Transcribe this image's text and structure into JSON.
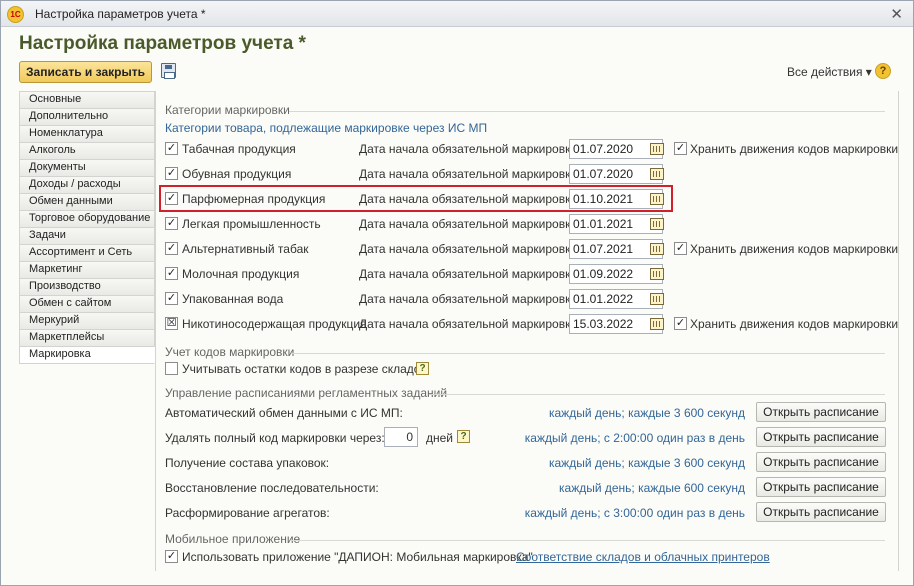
{
  "window": {
    "title": "Настройка параметров учета *",
    "logo": "1С"
  },
  "page": {
    "heading": "Настройка параметров учета *"
  },
  "toolbar": {
    "save_close": "Записать и закрыть",
    "all_actions": "Все действия ▾",
    "help": "?"
  },
  "nav": {
    "items": [
      "Основные",
      "Дополнительно",
      "Номенклатура",
      "Алкоголь",
      "Документы",
      "Доходы / расходы",
      "Обмен данными",
      "Торговое оборудование",
      "Задачи",
      "Ассортимент и Сеть",
      "Маркетинг",
      "Производство",
      "Обмен с сайтом",
      "Меркурий",
      "Маркетплейсы",
      "Маркировка"
    ],
    "active": "Маркировка"
  },
  "categories": {
    "title": "Категории маркировки",
    "subtitle": "Категории товара, подлежащие маркировке через ИС МП",
    "date_label": "Дата начала обязательной маркировки:",
    "store_label": "Хранить движения кодов маркировки",
    "rows": [
      {
        "name": "Табачная продукция",
        "date": "01.07.2020",
        "store": true,
        "state": "checked"
      },
      {
        "name": "Обувная продукция",
        "date": "01.07.2020",
        "store": false,
        "state": "checked"
      },
      {
        "name": "Парфюмерная продукция",
        "date": "01.10.2021",
        "store": false,
        "state": "checked"
      },
      {
        "name": "Легкая промышленность",
        "date": "01.01.2021",
        "store": false,
        "state": "checked"
      },
      {
        "name": "Альтернативный табак",
        "date": "01.07.2021",
        "store": true,
        "state": "checked"
      },
      {
        "name": "Молочная продукция",
        "date": "01.09.2022",
        "store": false,
        "state": "checked"
      },
      {
        "name": "Упакованная вода",
        "date": "01.01.2022",
        "store": false,
        "state": "checked"
      },
      {
        "name": "Никотиносодержащая продукция",
        "date": "15.03.2022",
        "store": true,
        "state": "partial"
      }
    ]
  },
  "codes": {
    "title": "Учет кодов маркировки",
    "warehouse_label": "Учитывать остатки кодов в разрезе складов"
  },
  "schedule": {
    "title": "Управление расписаниями регламентных заданий",
    "button_label": "Открыть расписание",
    "days_unit": "дней",
    "days_value": "0",
    "rows": [
      {
        "label": "Автоматический обмен данными с ИС МП:",
        "schedule": "каждый день; каждые 3 600 секунд"
      },
      {
        "label": "Удалять полный код маркировки через:",
        "schedule": "каждый день; с 2:00:00 один раз в день"
      },
      {
        "label": "Получение состава упаковок:",
        "schedule": "каждый день; каждые 3 600 секунд"
      },
      {
        "label": "Восстановление последовательности:",
        "schedule": "каждый день; каждые 600 секунд"
      },
      {
        "label": "Расформирование агрегатов:",
        "schedule": "каждый день; с 3:00:00 один раз в день"
      }
    ]
  },
  "mobile": {
    "title": "Мобильное приложение",
    "use_label": "Использовать приложение \"ДАПИОН: Мобильная маркировка\"",
    "link": "Соответствие складов и облачных принтеров"
  },
  "icons": {
    "calendar": "calendar-icon",
    "help": "question-icon",
    "save": "floppy-icon",
    "close": "close-icon"
  }
}
